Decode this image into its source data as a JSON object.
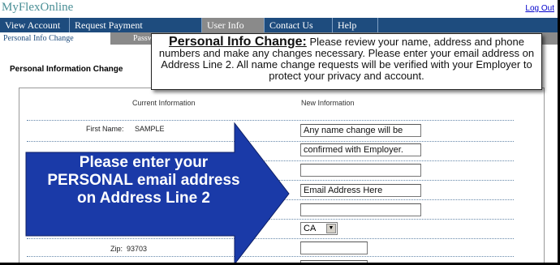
{
  "app": {
    "brand": "MyFlexOnline",
    "logout_label": "Log Out"
  },
  "nav": {
    "items": [
      "View Account",
      "Request Payment",
      "User Info",
      "Contact Us",
      "Help"
    ],
    "active": "User Info"
  },
  "subnav": {
    "items": [
      "Personal Info Change",
      "Passw"
    ]
  },
  "page": {
    "section_title": "Personal Information Change"
  },
  "callout": {
    "title": "Personal Info Change:",
    "body": "Please review your  name, address and phone numbers and make any changes necessary.  Please enter your email address on Address Line 2.  All name change requests will be verified with your Employer to protect your privacy and account."
  },
  "form": {
    "current_header": "Current Information",
    "new_header": "New Information",
    "first_name_label": "First Name:",
    "first_name_value": "SAMPLE",
    "first_name_new": "Any name change will be",
    "last_name_new": "confirmed with Employer.",
    "address1_new": "",
    "address2_new": "Email Address Here",
    "city_new": "",
    "state_new": "CA",
    "zip_label": "Zip:",
    "zip_value": "93703",
    "zip_new": ""
  },
  "overlay": {
    "arrow_text": "Please enter your PERSONAL email address on Address Line 2",
    "arrow_color": "#1a3aa8"
  }
}
